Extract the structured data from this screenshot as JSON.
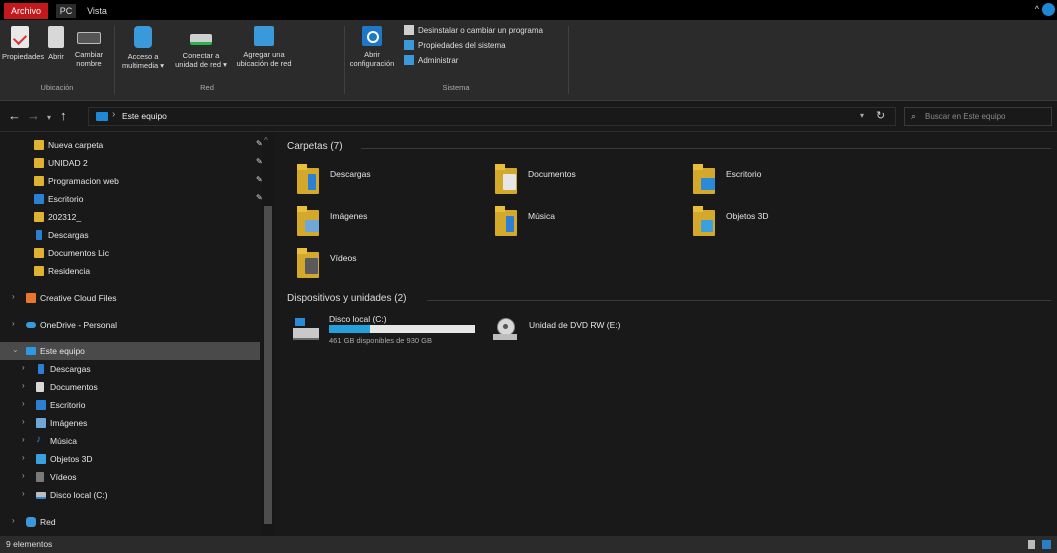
{
  "tabs": {
    "file": "Archivo",
    "pc": "PC",
    "view": "Vista"
  },
  "ribbon": {
    "location": {
      "group_label": "Ubicación",
      "properties": "Propiedades",
      "open": "Abrir",
      "rename_l1": "Cambiar",
      "rename_l2": "nombre"
    },
    "network": {
      "group_label": "Red",
      "media_l1": "Acceso a",
      "media_l2": "multimedia ▾",
      "map_l1": "Conectar a",
      "map_l2": "unidad de red ▾",
      "add_l1": "Agregar una",
      "add_l2": "ubicación de red"
    },
    "system": {
      "group_label": "Sistema",
      "settings_l1": "Abrir",
      "settings_l2": "configuración",
      "uninstall": "Desinstalar o cambiar un programa",
      "sys_props": "Propiedades del sistema",
      "manage": "Administrar"
    }
  },
  "address": {
    "location": "Este equipo",
    "search_placeholder": "Buscar en Este equipo"
  },
  "sidebar": {
    "quick": [
      "Nueva carpeta",
      "UNIDAD 2",
      "Programacion web",
      "Escritorio",
      "202312_",
      "Descargas",
      "Documentos Lic",
      "Residencia"
    ],
    "creative": "Creative Cloud Files",
    "onedrive": "OneDrive - Personal",
    "this_pc": "Este equipo",
    "pc_children": [
      "Descargas",
      "Documentos",
      "Escritorio",
      "Imágenes",
      "Música",
      "Objetos 3D",
      "Vídeos",
      "Disco local (C:)"
    ],
    "network": "Red"
  },
  "content": {
    "folders_header": "Carpetas (7)",
    "folders": [
      "Descargas",
      "Documentos",
      "Escritorio",
      "Imágenes",
      "Música",
      "Objetos 3D",
      "Vídeos"
    ],
    "devices_header": "Dispositivos y unidades (2)",
    "drive_c": {
      "name": "Disco local (C:)",
      "free": "461 GB disponibles de 930 GB",
      "used_fraction": 0.28
    },
    "dvd": {
      "name": "Unidad de DVD RW (E:)"
    }
  },
  "status": {
    "items": "9 elementos"
  },
  "colors": {
    "accent": "#26a0da",
    "file_tab": "#c4191c",
    "folder": "#d4a82b",
    "selection": "#4a4a4a",
    "background": "#191919"
  },
  "icons": {
    "up": "arrow-up-icon",
    "refresh": "refresh-icon",
    "search": "search-icon",
    "settings": "gear-icon"
  }
}
